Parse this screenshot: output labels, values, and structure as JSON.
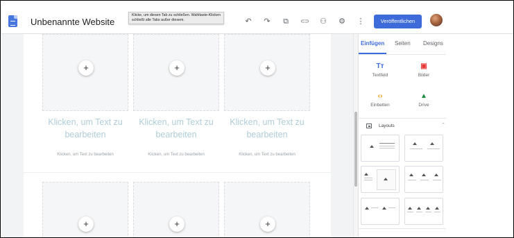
{
  "app": {
    "title": "Unbenannte Website",
    "tooltip": "Klicke, um diesen Tab zu schließen. Wahltaste-Klicken schließt alle Tabs außer diesem.",
    "publish_label": "Veröffentlichen",
    "accent_color": "#3d6bd9"
  },
  "toolbar": {
    "icons": [
      "undo-icon",
      "redo-icon",
      "preview-icon",
      "link-icon",
      "share-icon",
      "settings-icon",
      "more-icon"
    ],
    "glyphs": [
      "↶",
      "↷",
      "⧉",
      "⊂⊃",
      "⚇",
      "⚙",
      "⋮"
    ]
  },
  "canvas": {
    "placeholder_plus": "+",
    "heading_placeholder": "Klicken, um Text zu bearbeiten",
    "caption_placeholder": "Klicken, um Text zu bearbeiten"
  },
  "panel": {
    "tabs": [
      {
        "label": "Einfügen",
        "active": true
      },
      {
        "label": "Seiten",
        "active": false
      },
      {
        "label": "Designs",
        "active": false
      }
    ],
    "insert_items": [
      {
        "label": "Textfeld",
        "icon": "text-box-icon",
        "glyph": "Tт",
        "color": "#3d6bd9"
      },
      {
        "label": "Bilder",
        "icon": "image-icon",
        "glyph": "▣",
        "color": "#e53935"
      },
      {
        "label": "Einbetten",
        "icon": "embed-icon",
        "glyph": "‹›",
        "color": "#f29900"
      },
      {
        "label": "Drive",
        "icon": "drive-icon",
        "glyph": "▲",
        "color": "#1e8e3e"
      }
    ],
    "layouts_label": "Layouts",
    "layouts_chevron": "⌃"
  }
}
